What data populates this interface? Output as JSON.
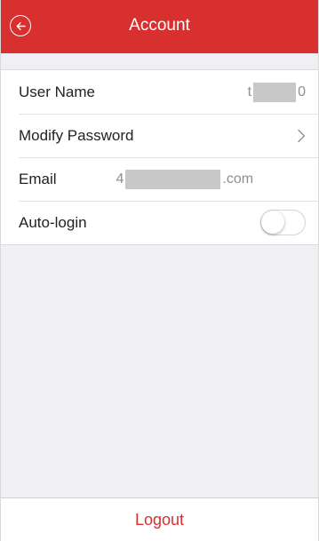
{
  "header": {
    "title": "Account",
    "back_icon": "back-circle-arrow-icon"
  },
  "account": {
    "username_label": "User Name",
    "username_prefix": "t",
    "username_suffix": "0",
    "modify_password_label": "Modify Password",
    "modify_password_icon": "chevron-right-icon",
    "email_label": "Email",
    "email_prefix": "4",
    "email_suffix": ".com",
    "autologin_label": "Auto-login",
    "autologin_enabled": false
  },
  "footer": {
    "logout_label": "Logout"
  },
  "colors": {
    "accent": "#d8302f",
    "background": "#efeff4",
    "text_secondary": "#8e8e93"
  }
}
